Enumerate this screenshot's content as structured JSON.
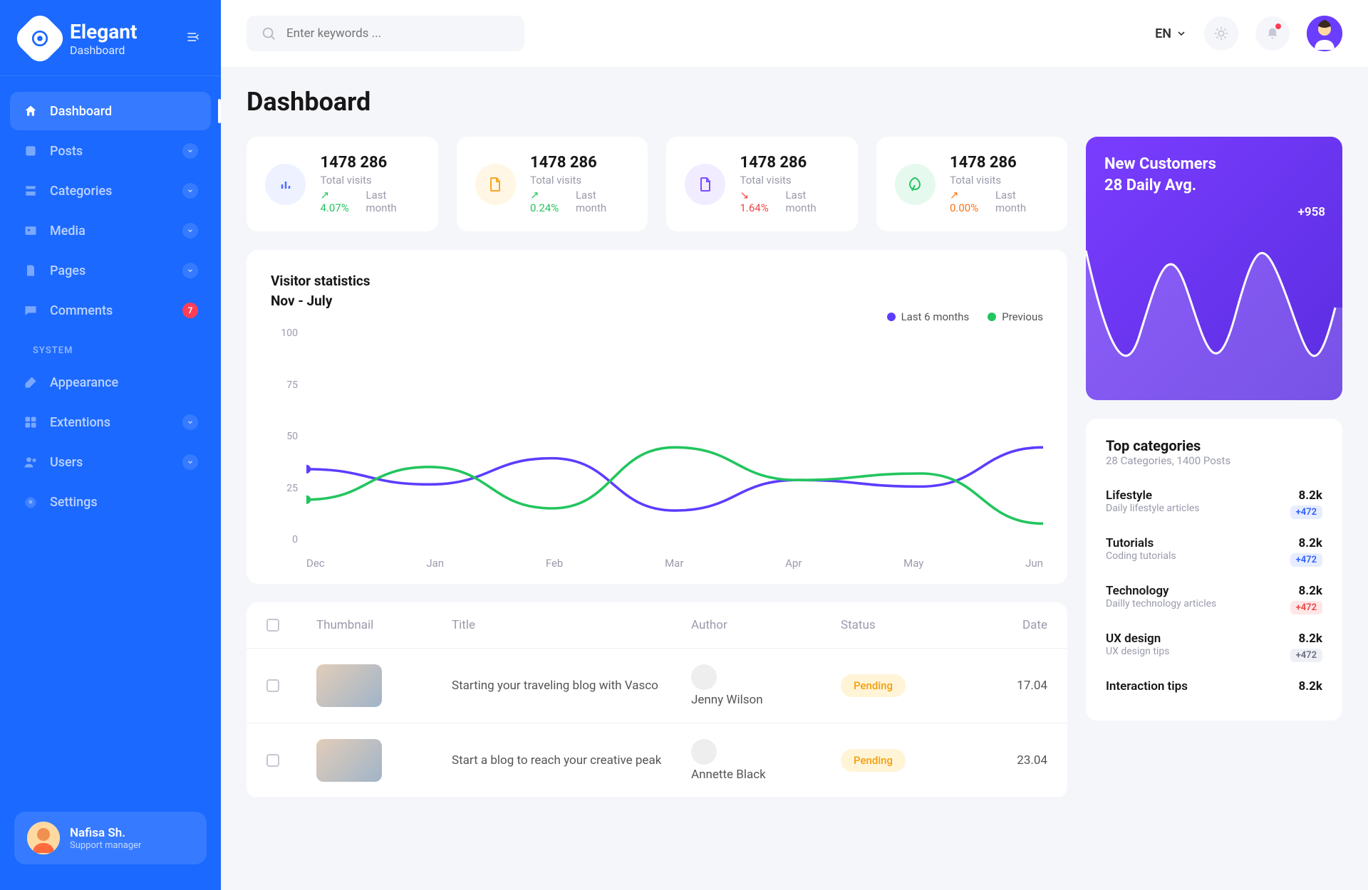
{
  "brand": {
    "title": "Elegant",
    "subtitle": "Dashboard"
  },
  "sidebar": {
    "items": [
      {
        "label": "Dashboard"
      },
      {
        "label": "Posts"
      },
      {
        "label": "Categories"
      },
      {
        "label": "Media"
      },
      {
        "label": "Pages"
      },
      {
        "label": "Comments",
        "badge": "7"
      }
    ],
    "section": "SYSTEM",
    "system": [
      {
        "label": "Appearance"
      },
      {
        "label": "Extentions"
      },
      {
        "label": "Users"
      },
      {
        "label": "Settings"
      }
    ],
    "user": {
      "name": "Nafisa Sh.",
      "role": "Support manager"
    }
  },
  "topbar": {
    "search_placeholder": "Enter keywords ...",
    "lang": "EN"
  },
  "page": {
    "title": "Dashboard"
  },
  "stats": [
    {
      "value": "1478 286",
      "label": "Total visits",
      "delta": "4.07%",
      "period": "Last month",
      "trend": "up",
      "icon_bg": "#eef1ff",
      "icon_color": "#4f6bff"
    },
    {
      "value": "1478 286",
      "label": "Total visits",
      "delta": "0.24%",
      "period": "Last month",
      "trend": "up",
      "icon_bg": "#fff6e5",
      "icon_color": "#f5a524"
    },
    {
      "value": "1478 286",
      "label": "Total visits",
      "delta": "1.64%",
      "period": "Last month",
      "trend": "down",
      "icon_bg": "#f1ecff",
      "icon_color": "#7c4dff"
    },
    {
      "value": "1478 286",
      "label": "Total visits",
      "delta": "0.00%",
      "period": "Last month",
      "trend": "flat",
      "icon_bg": "#e6f9ef",
      "icon_color": "#22c55e"
    }
  ],
  "chart_data": {
    "type": "line",
    "title": "Visitor statistics",
    "subtitle": "Nov - July",
    "ylim": [
      0,
      100
    ],
    "y_ticks": [
      "100",
      "75",
      "50",
      "25",
      "0"
    ],
    "categories": [
      "Dec",
      "Jan",
      "Feb",
      "Mar",
      "Apr",
      "May",
      "Jun"
    ],
    "series": [
      {
        "name": "Last 6 months",
        "color": "#5b3dff",
        "values": [
          35,
          28,
          40,
          16,
          30,
          27,
          45
        ]
      },
      {
        "name": "Previous",
        "color": "#22c55e",
        "values": [
          21,
          36,
          17,
          45,
          30,
          33,
          10
        ]
      }
    ]
  },
  "table": {
    "headers": {
      "thumbnail": "Thumbnail",
      "title": "Title",
      "author": "Author",
      "status": "Status",
      "date": "Date"
    },
    "rows": [
      {
        "title": "Starting your traveling blog with Vasco",
        "author": "Jenny Wilson",
        "status": "Pending",
        "date": "17.04"
      },
      {
        "title": "Start a blog to reach your creative peak",
        "author": "Annette Black",
        "status": "Pending",
        "date": "23.04"
      }
    ]
  },
  "promo": {
    "line1": "New Customers",
    "line2": "28 Daily Avg.",
    "delta": "+958"
  },
  "categories": {
    "title": "Top categories",
    "subtitle": "28 Categories, 1400 Posts",
    "items": [
      {
        "name": "Lifestyle",
        "desc": "Daily lifestyle articles",
        "count": "8.2k",
        "badge": "+472",
        "badge_color": "blue"
      },
      {
        "name": "Tutorials",
        "desc": "Coding tutorials",
        "count": "8.2k",
        "badge": "+472",
        "badge_color": "blue"
      },
      {
        "name": "Technology",
        "desc": "Dailly technology articles",
        "count": "8.2k",
        "badge": "+472",
        "badge_color": "red"
      },
      {
        "name": "UX design",
        "desc": "UX design tips",
        "count": "8.2k",
        "badge": "+472",
        "badge_color": "gray"
      },
      {
        "name": "Interaction tips",
        "desc": "",
        "count": "8.2k",
        "badge": "",
        "badge_color": ""
      }
    ]
  }
}
